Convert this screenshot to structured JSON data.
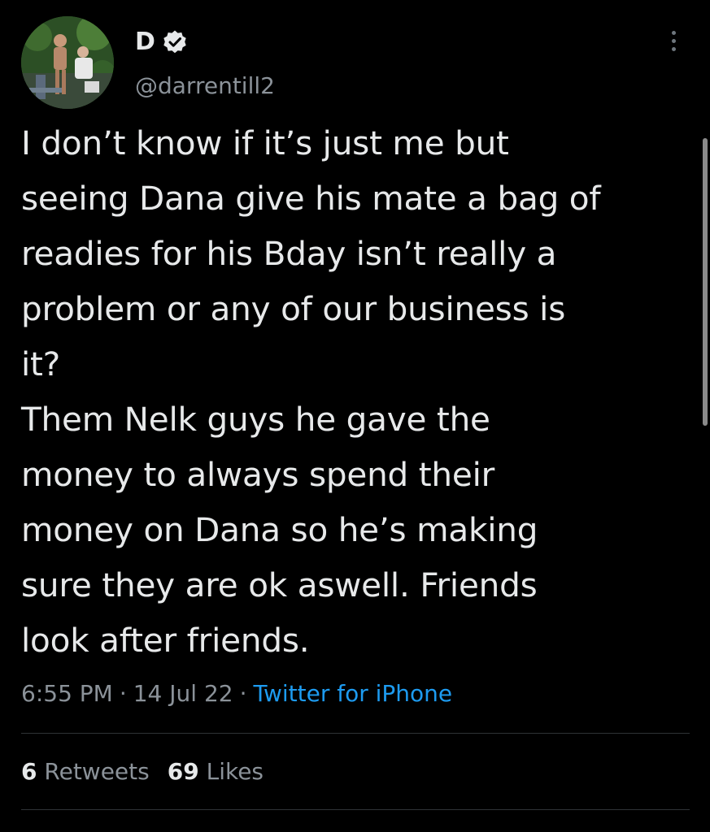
{
  "author": {
    "display_name": "D",
    "handle": "@darrentill2",
    "verified_icon": "verified-badge-icon",
    "avatar": "profile-photo"
  },
  "tweet": {
    "text": "I don’t know if it’s just me but\nseeing Dana give his mate a bag of\nreadies for his Bday isn’t really a\nproblem or any of our business is\nit?\nThem Nelk guys he gave the\nmoney to always spend their\nmoney on Dana so he’s making\nsure they are ok aswell. Friends\nlook after friends.",
    "time": "6:55 PM",
    "separator": "·",
    "date": "14 Jul 22",
    "source": "Twitter for iPhone"
  },
  "stats": {
    "retweets_count": "6",
    "retweets_label": "Retweets",
    "likes_count": "69",
    "likes_label": "Likes"
  },
  "icons": {
    "more": "more-vertical-icon"
  },
  "colors": {
    "background": "#000000",
    "text": "#e7e9ea",
    "secondary": "#8b9299",
    "link": "#1d9bf0",
    "divider": "#2f3336"
  }
}
